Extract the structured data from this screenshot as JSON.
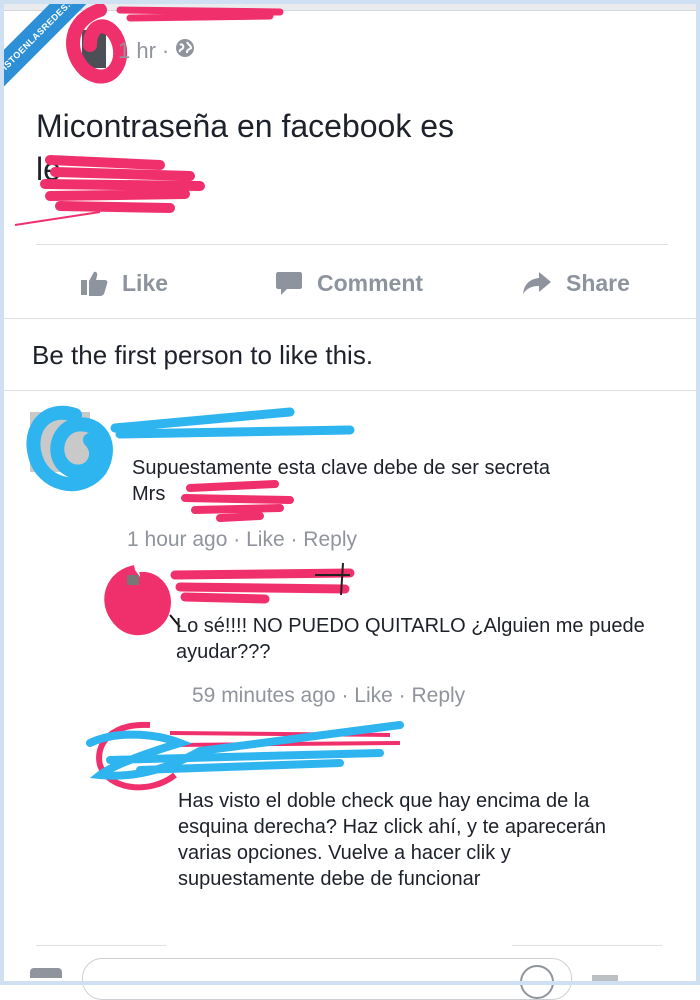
{
  "watermark": {
    "text": "VISTOENLASREDES.com"
  },
  "post": {
    "time": "1 hr",
    "separator": "·",
    "audience_icon": "globe-icon",
    "text_line1": "Micontraseña en facebook es",
    "text_line2": "le"
  },
  "actions": {
    "like": "Like",
    "comment": "Comment",
    "share": "Share"
  },
  "likes_line": "Be the first person to like this.",
  "comments": [
    {
      "text_line1": "Supuestamente esta clave debe de ser secreta",
      "text_line2": "Mrs",
      "time": "1 hour ago",
      "like": "Like",
      "reply": "Reply"
    },
    {
      "text_line1": "Lo sé!!!! NO PUEDO QUITARLO ¿Alguien me puede",
      "text_line2": "ayudar???",
      "time": "59 minutes ago",
      "like": "Like",
      "reply": "Reply"
    },
    {
      "text_lines": [
        "Has visto el doble check que hay encima de la",
        "esquina derecha? Haz click ahí, y te aparecerán",
        "varias opciones. Vuelve a hacer clik y",
        "supuestamente debe de funcionar"
      ]
    }
  ],
  "colors": {
    "redaction_pink": "#f0306c",
    "redaction_blue": "#2eb4ef",
    "action_grey": "#8d949e",
    "meta_grey": "#90949c",
    "watermark_blue": "#2d8fd5"
  }
}
